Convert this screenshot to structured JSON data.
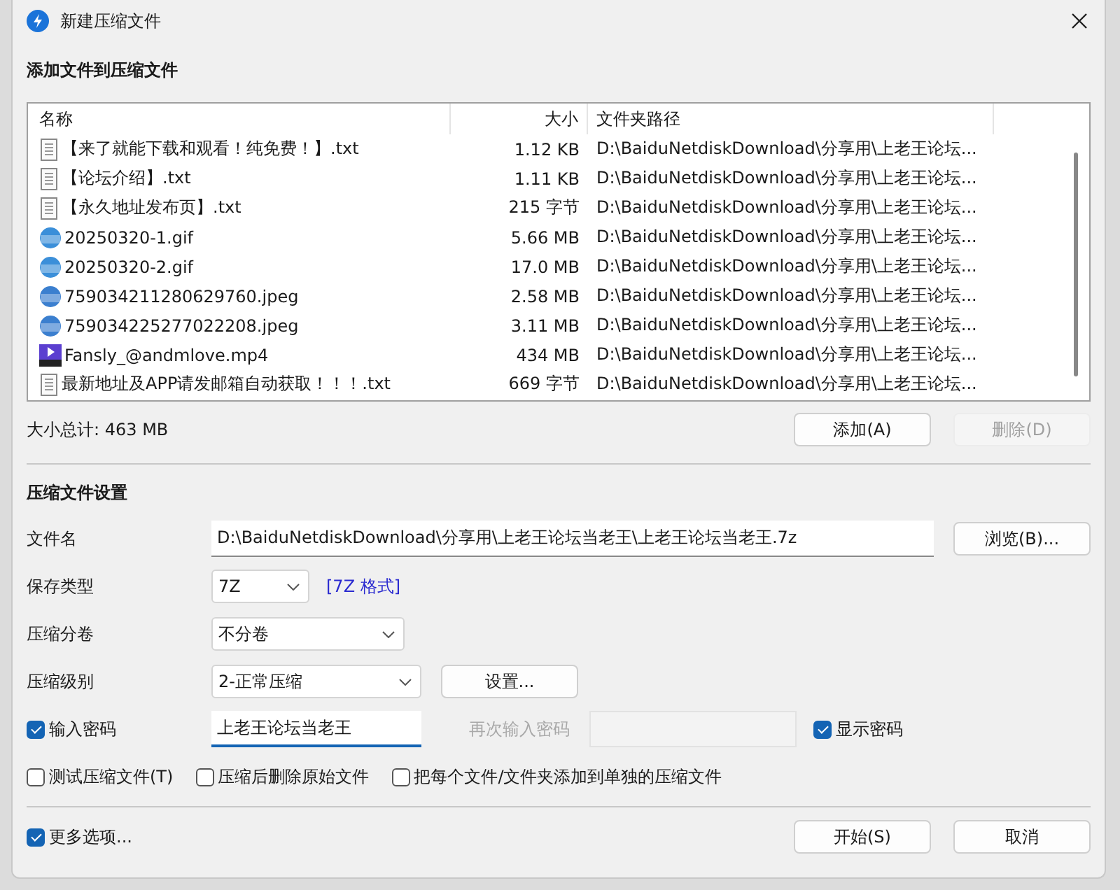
{
  "window": {
    "title": "新建压缩文件"
  },
  "files_section": {
    "title": "添加文件到压缩文件",
    "columns": [
      "名称",
      "大小",
      "文件夹路径"
    ],
    "rows": [
      {
        "kind": "txt",
        "name": "【来了就能下载和观看！纯免费！】.txt",
        "size": "1.12 KB",
        "path": "D:\\BaiduNetdiskDownload\\分享用\\上老王论坛..."
      },
      {
        "kind": "txt",
        "name": "【论坛介绍】.txt",
        "size": "1.11 KB",
        "path": "D:\\BaiduNetdiskDownload\\分享用\\上老王论坛..."
      },
      {
        "kind": "txt",
        "name": "【永久地址发布页】.txt",
        "size": "215 字节",
        "path": "D:\\BaiduNetdiskDownload\\分享用\\上老王论坛..."
      },
      {
        "kind": "gif",
        "name": "20250320-1.gif",
        "size": "5.66 MB",
        "path": "D:\\BaiduNetdiskDownload\\分享用\\上老王论坛..."
      },
      {
        "kind": "gif",
        "name": "20250320-2.gif",
        "size": "17.0 MB",
        "path": "D:\\BaiduNetdiskDownload\\分享用\\上老王论坛..."
      },
      {
        "kind": "jpg",
        "name": "759034211280629760.jpeg",
        "size": "2.58 MB",
        "path": "D:\\BaiduNetdiskDownload\\分享用\\上老王论坛..."
      },
      {
        "kind": "jpg",
        "name": "759034225277022208.jpeg",
        "size": "3.11 MB",
        "path": "D:\\BaiduNetdiskDownload\\分享用\\上老王论坛..."
      },
      {
        "kind": "mp4",
        "name": "Fansly_@andmlove.mp4",
        "size": "434 MB",
        "path": "D:\\BaiduNetdiskDownload\\分享用\\上老王论坛..."
      },
      {
        "kind": "txt",
        "name": "最新地址及APP请发邮箱自动获取！！！.txt",
        "size": "669 字节",
        "path": "D:\\BaiduNetdiskDownload\\分享用\\上老王论坛..."
      }
    ],
    "total": "大小总计: 463 MB",
    "buttons": [
      {
        "label": "添加(A)",
        "disabled": false
      },
      {
        "label": "删除(D)",
        "disabled": true
      }
    ]
  },
  "settings": {
    "title": "压缩文件设置",
    "filename": {
      "label": "文件名",
      "value": "D:\\BaiduNetdiskDownload\\分享用\\上老王论坛当老王\\上老王论坛当老王.7z",
      "button": "浏览(B)..."
    },
    "format": {
      "label": "保存类型",
      "value": "7Z",
      "note": "[7Z 格式]"
    },
    "volume": {
      "label": "压缩分卷",
      "value": "不分卷"
    },
    "level": {
      "label": "压缩级别",
      "value": "2-正常压缩",
      "button": "设置..."
    },
    "password": {
      "label": "输入密码",
      "checked": true,
      "value": "上老王论坛当老王",
      "repeat_label": "再次输入密码",
      "show_label": "显示密码",
      "show_checked": true
    },
    "options": [
      {
        "label": "测试压缩文件(T)",
        "checked": false
      },
      {
        "label": "压缩后删除原始文件",
        "checked": false
      },
      {
        "label": "把每个文件/文件夹添加到单独的压缩文件",
        "checked": false
      }
    ]
  },
  "footer": {
    "more": {
      "label": "更多选项...",
      "checked": true
    },
    "buttons": [
      {
        "label": "开始(S)"
      },
      {
        "label": "取消"
      }
    ]
  }
}
